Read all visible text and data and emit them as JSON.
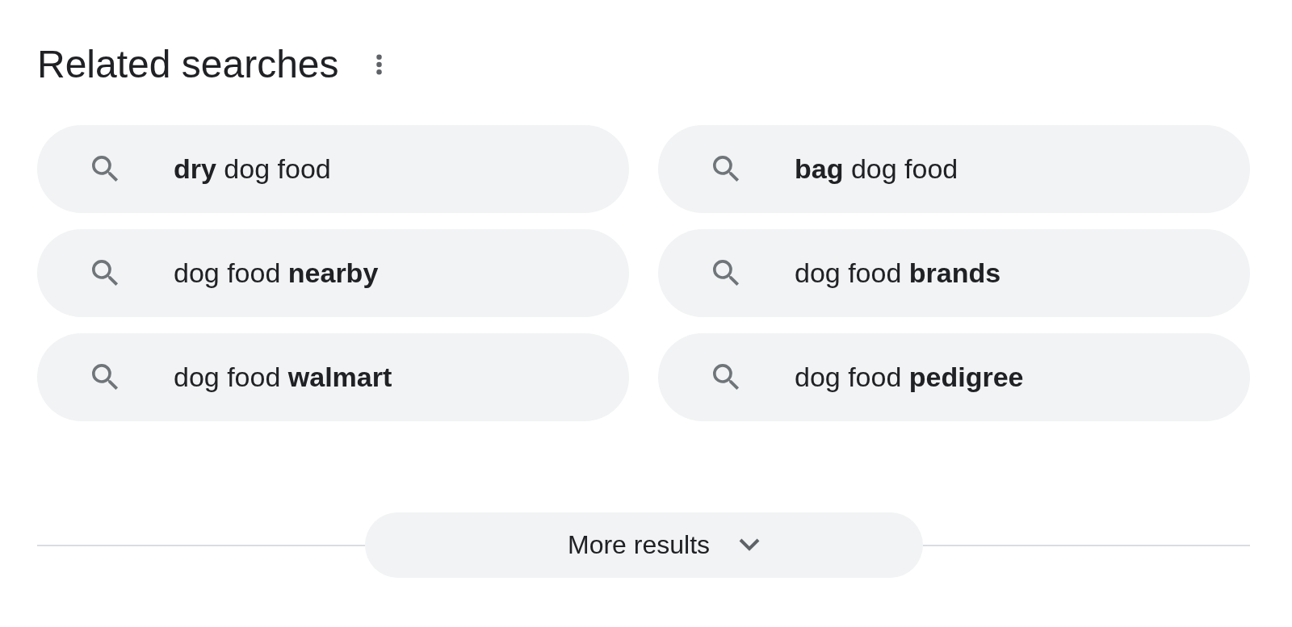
{
  "header": {
    "title": "Related searches"
  },
  "related_searches": [
    {
      "text": "**dry** dog food"
    },
    {
      "text": "**bag** dog food"
    },
    {
      "text": "dog food **nearby**"
    },
    {
      "text": "dog food **brands**"
    },
    {
      "text": "dog food **walmart**"
    },
    {
      "text": "dog food **pedigree**"
    }
  ],
  "more_results": {
    "label": "More results"
  }
}
